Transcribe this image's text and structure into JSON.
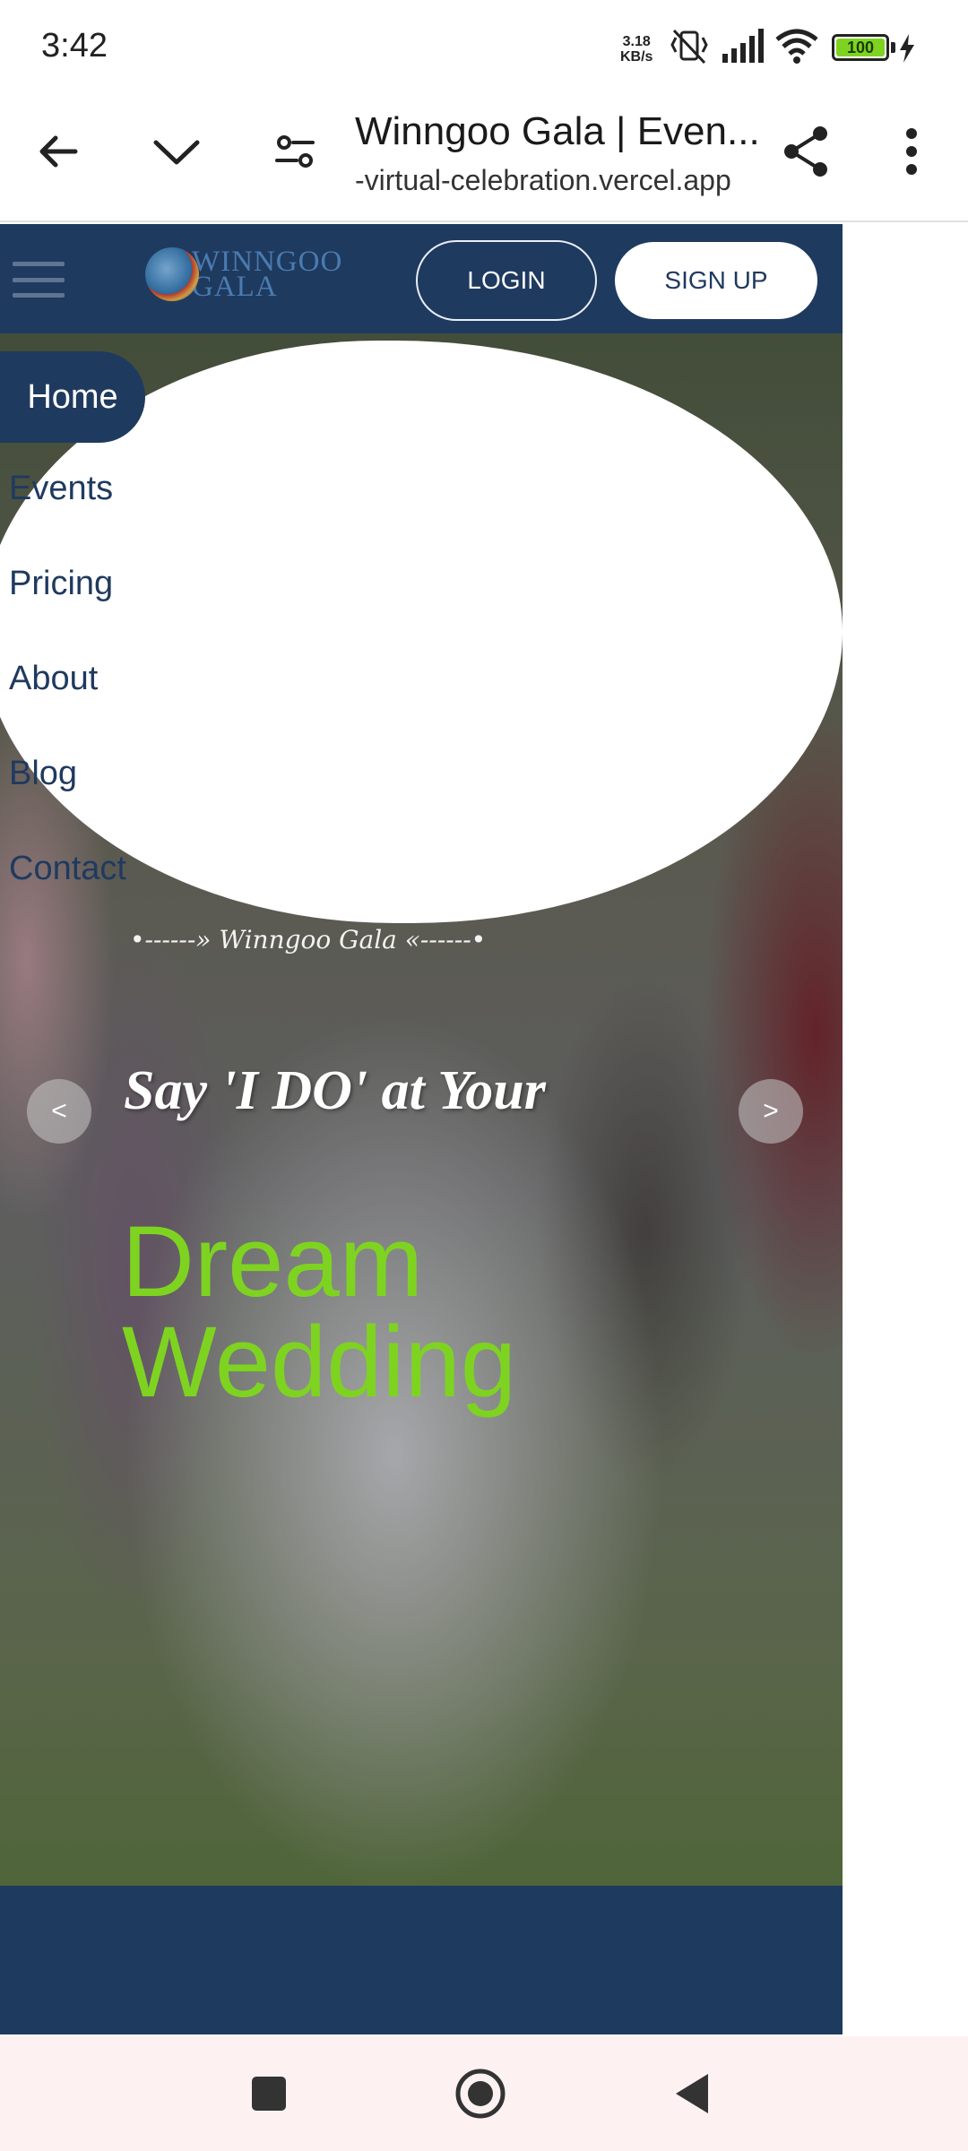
{
  "status_bar": {
    "time": "3:42",
    "net_speed_value": "3.18",
    "net_speed_unit": "KB/s",
    "battery": "100"
  },
  "browser": {
    "title": "Winngoo Gala | Even...",
    "url": "-virtual-celebration.vercel.app"
  },
  "site": {
    "logo_line1": "WINNGOO",
    "logo_line2": "GALA",
    "login_label": "LOGIN",
    "signup_label": "SIGN UP",
    "nav_items": [
      "Home",
      "Events",
      "Pricing",
      "About",
      "Blog",
      "Contact"
    ],
    "tagline": "•------» Winngoo Gala «------•",
    "subtitle": "Say 'I DO' at Your",
    "headline_line1": "Dream",
    "headline_line2": "Wedding",
    "prev_label": "<",
    "next_label": ">"
  },
  "colors": {
    "brand_navy": "#1f3a5f",
    "headline_green": "#7ed321"
  }
}
